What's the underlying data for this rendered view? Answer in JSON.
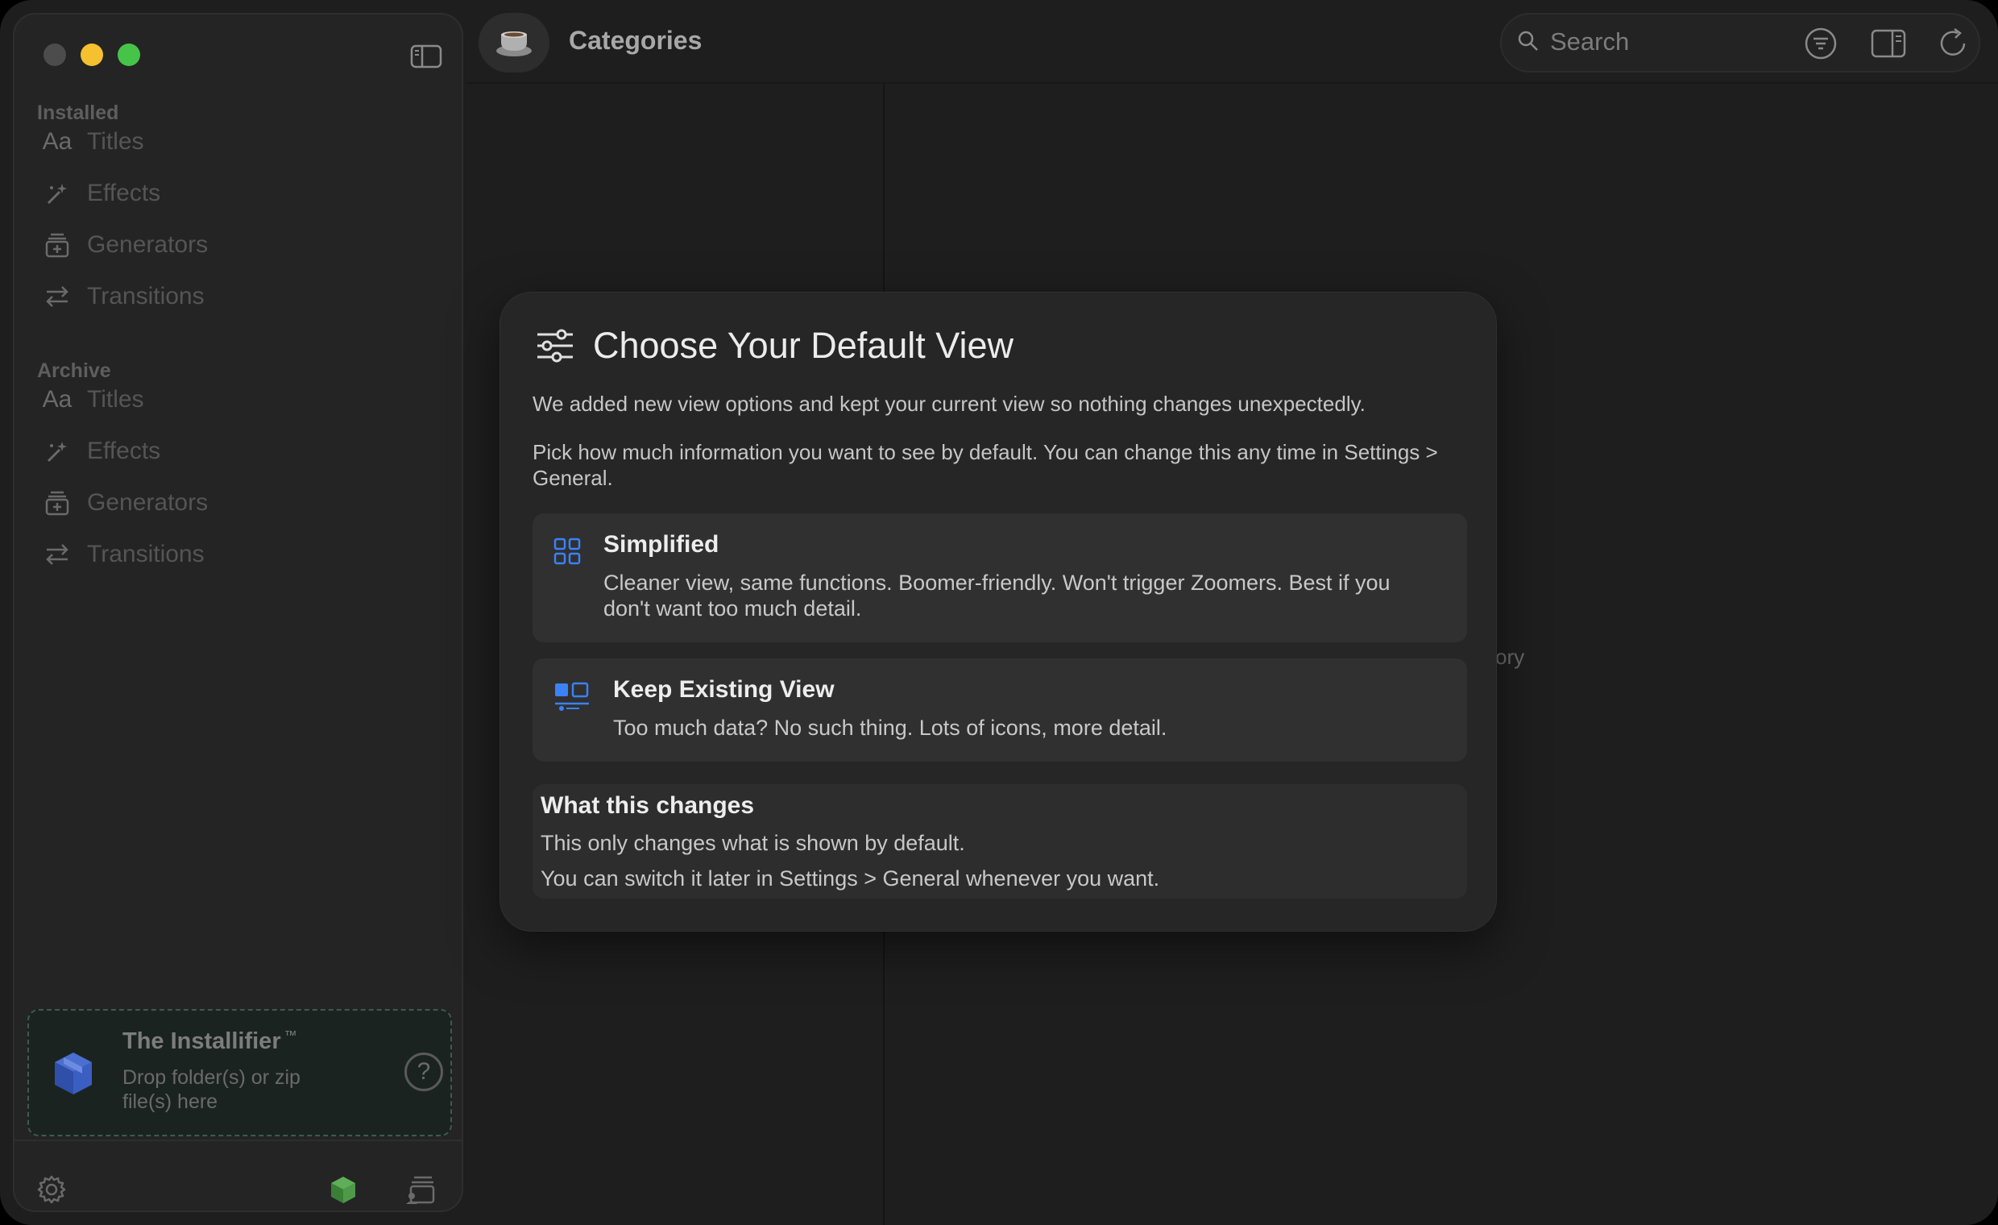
{
  "window": {
    "traffic_lights": [
      "close",
      "minimize",
      "maximize"
    ],
    "accent_color": "#3b82f6"
  },
  "sidebar": {
    "sections": [
      {
        "label": "Installed",
        "items": [
          {
            "icon": "aa-text-icon",
            "icon_text": "Aa",
            "label": "Titles"
          },
          {
            "icon": "magic-wand-icon",
            "label": "Effects"
          },
          {
            "icon": "generator-icon",
            "label": "Generators"
          },
          {
            "icon": "arrows-swap-icon",
            "label": "Transitions"
          }
        ]
      },
      {
        "label": "Archive",
        "items": [
          {
            "icon": "aa-text-icon",
            "icon_text": "Aa",
            "label": "Titles"
          },
          {
            "icon": "magic-wand-icon",
            "label": "Effects"
          },
          {
            "icon": "generator-icon",
            "label": "Generators"
          },
          {
            "icon": "arrows-swap-icon",
            "label": "Transitions"
          }
        ]
      }
    ],
    "installifier": {
      "title": "The Installifier",
      "trademark": "™",
      "subtitle": "Drop folder(s) or zip file(s) here",
      "help_symbol": "?"
    }
  },
  "toolbar": {
    "title": "Categories",
    "search_placeholder": "Search"
  },
  "background": {
    "peek_text": "ory"
  },
  "dialog": {
    "title": "Choose Your Default View",
    "paragraph1": "We added new view options and kept your current view so nothing changes unexpectedly.",
    "paragraph2": "Pick how much information you want to see by default. You can change this any time in Settings > General.",
    "options": [
      {
        "title": "Simplified",
        "description": "Cleaner view, same functions. Boomer-friendly. Won't trigger Zoomers. Best if you don't want too much detail."
      },
      {
        "title": "Keep Existing View",
        "description": "Too much data? No such thing. Lots of icons, more detail."
      }
    ],
    "info": {
      "title": "What this changes",
      "line1": "This only changes what is shown by default.",
      "line2": "You can switch it later in Settings > General whenever you want."
    }
  }
}
